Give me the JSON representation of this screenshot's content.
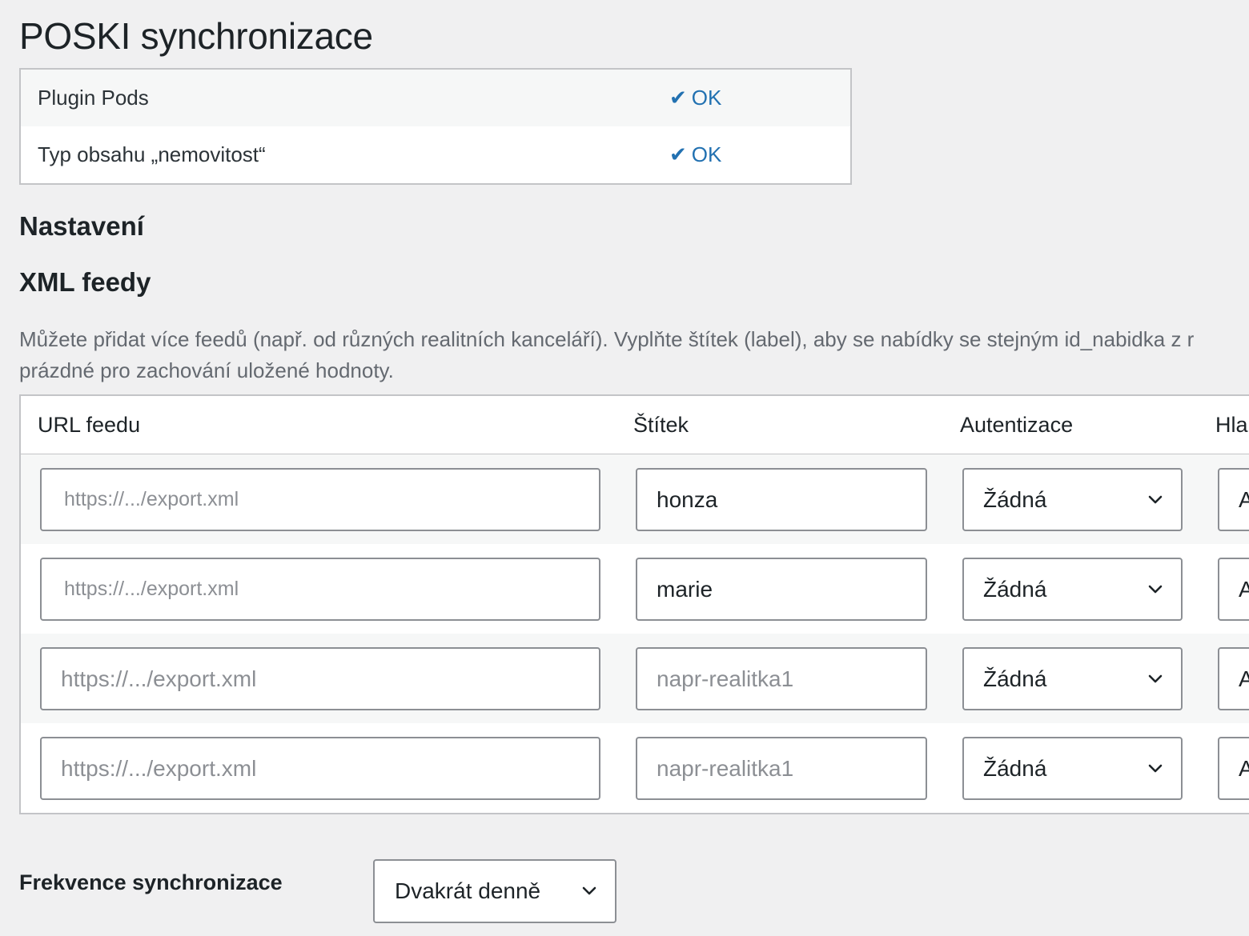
{
  "page_title": "POSKI synchronizace",
  "status": [
    {
      "label": "Plugin Pods",
      "value": "OK"
    },
    {
      "label": "Typ obsahu „nemovitost“",
      "value": "OK"
    }
  ],
  "status_icon": "check-icon",
  "status_color": "#2271b1",
  "sections": {
    "settings": "Nastavení",
    "xml_feeds": "XML feedy"
  },
  "description_line1": "Můžete přidat více feedů (např. od různých realitních kanceláří). Vyplňte štítek (label), aby se nabídky se stejným id_nabidka z r",
  "description_line2": "prázdné pro zachování uložené hodnoty.",
  "feeds": {
    "columns": [
      "URL feedu",
      "Štítek",
      "Autentizace",
      "Hla"
    ],
    "rows": [
      {
        "url_placeholder": "https://.../export.xml",
        "label_value": "honza",
        "label_placeholder": "",
        "auth": "Žádná",
        "head_partial": "A"
      },
      {
        "url_placeholder": "https://.../export.xml",
        "label_value": "marie",
        "label_placeholder": "",
        "auth": "Žádná",
        "head_partial": "A"
      },
      {
        "url_placeholder": "https://.../export.xml",
        "label_value": "",
        "label_placeholder": "napr-realitka1",
        "auth": "Žádná",
        "head_partial": "A"
      },
      {
        "url_placeholder": "https://.../export.xml",
        "label_value": "",
        "label_placeholder": "napr-realitka1",
        "auth": "Žádná",
        "head_partial": "A"
      }
    ]
  },
  "frequency": {
    "label": "Frekvence synchronizace",
    "selected": "Dvakrát denně"
  }
}
